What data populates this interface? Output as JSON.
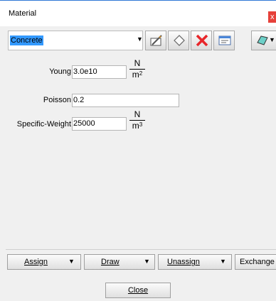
{
  "window": {
    "title": "Material",
    "close_glyph": "x"
  },
  "material_combo": {
    "value": "Concrete",
    "arrow": "▼"
  },
  "toolbar": {
    "icons": [
      "edit-icon",
      "new-material-icon",
      "delete-icon",
      "properties-icon",
      "tools-dropdown-icon"
    ],
    "dropdown_arrow": "▼"
  },
  "properties": [
    {
      "label": "Young",
      "value": "3.0e10",
      "unit_num": "N",
      "unit_den": "m",
      "unit_exp": "2"
    },
    {
      "label": "Poisson",
      "value": "0.2"
    },
    {
      "label": "Specific-Weight",
      "value": "25000",
      "unit_num": "N",
      "unit_den": "m",
      "unit_exp": "3"
    }
  ],
  "actions": {
    "assign": "Assign",
    "draw": "Draw",
    "unassign": "Unassign",
    "exchange": "Exchange",
    "dropdown_arrow": "▼"
  },
  "close_label": "Close",
  "colors": {
    "selection": "#3399ff",
    "delete_red": "#e8262a",
    "client_bg": "#f0f0f0",
    "title_border": "#2f78d6"
  }
}
